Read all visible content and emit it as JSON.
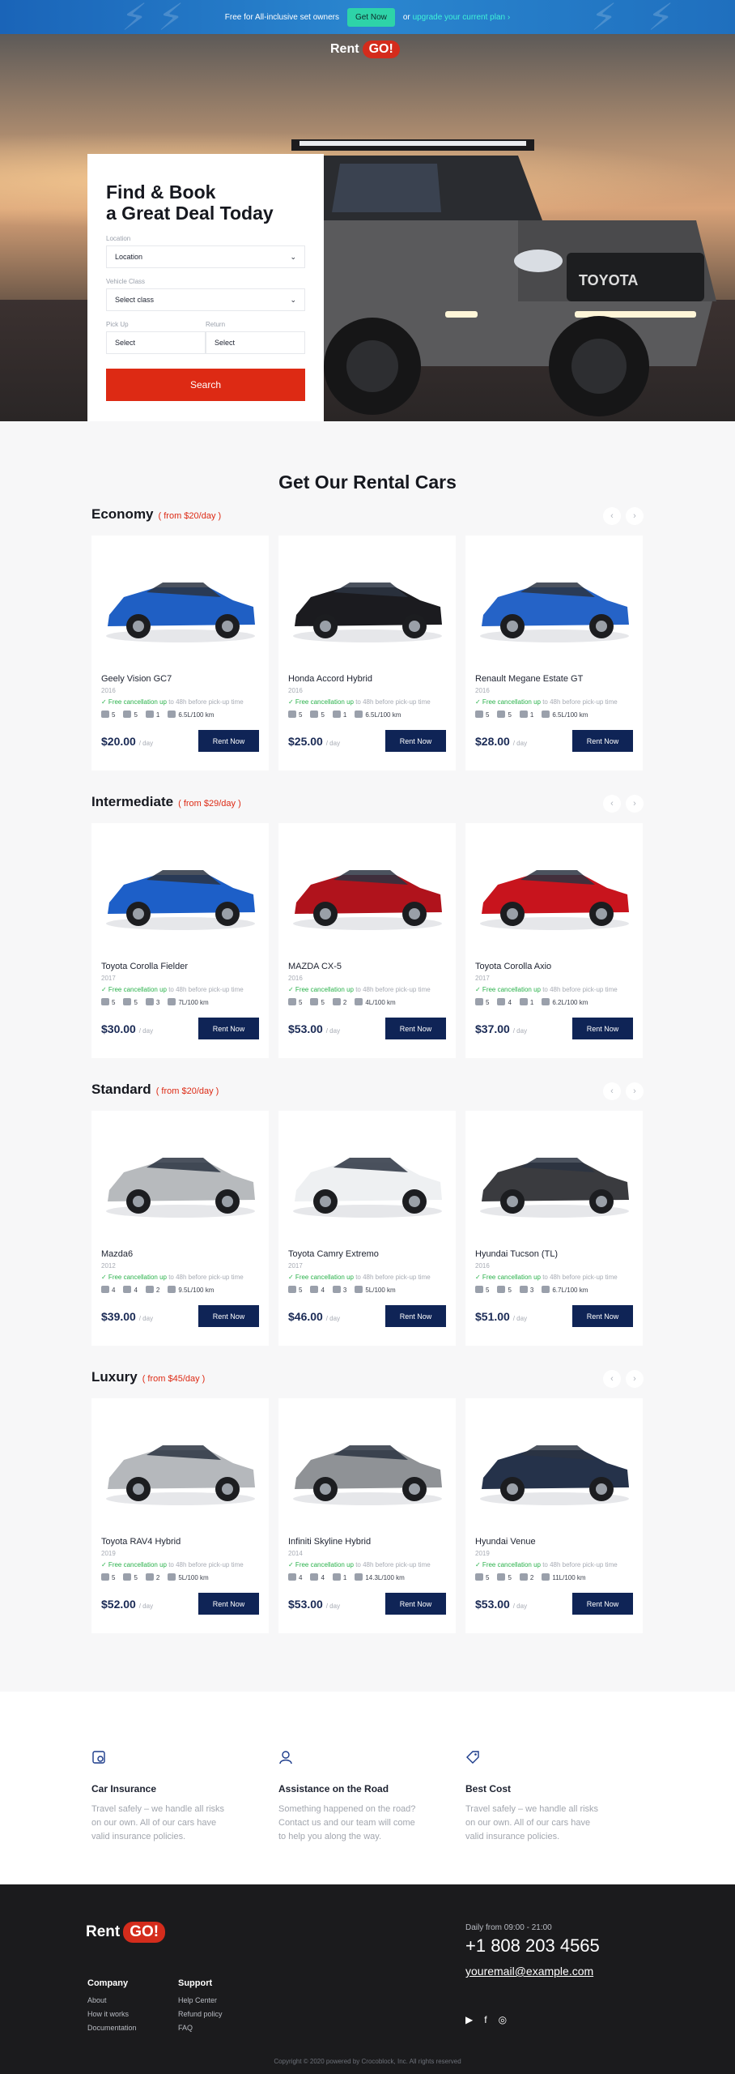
{
  "promo": {
    "text": "Free for All-inclusive set owners",
    "button": "Get Now",
    "or": "or",
    "upgrade": "upgrade your current plan ›"
  },
  "brand": {
    "rent": "Rent",
    "go": "GO!"
  },
  "finder": {
    "title_line1": "Find & Book",
    "title_line2": "a Great Deal Today",
    "location_label": "Location",
    "location_value": "Location",
    "class_label": "Vehicle Class",
    "class_value": "Select class",
    "pickup_label": "Pick Up",
    "pickup_value": "Select",
    "return_label": "Return",
    "return_value": "Select",
    "search": "Search"
  },
  "section_title": "Get Our Rental Cars",
  "free_cancel": "✓ Free cancellation up",
  "cancel_rest": " to 48h before pick-up time",
  "per_day": "/ day",
  "rent_now": "Rent Now",
  "categories": [
    {
      "name": "Economy",
      "from": "( from $20/day )",
      "cars": [
        {
          "model": "Geely Vision GC7",
          "year": "2016",
          "seats": "5",
          "doors": "5",
          "bags": "1",
          "fuel": "6.5L/100 km",
          "price": "$20.00",
          "color": "#1f5fc4"
        },
        {
          "model": "Honda Accord Hybrid",
          "year": "2016",
          "seats": "5",
          "doors": "5",
          "bags": "1",
          "fuel": "6.5L/100 km",
          "price": "$25.00",
          "color": "#1b1b1f"
        },
        {
          "model": "Renault Megane Estate GT",
          "year": "2016",
          "seats": "5",
          "doors": "5",
          "bags": "1",
          "fuel": "6.5L/100 km",
          "price": "$28.00",
          "color": "#2563c7"
        }
      ]
    },
    {
      "name": "Intermediate",
      "from": "( from $29/day )",
      "cars": [
        {
          "model": "Toyota Corolla Fielder",
          "year": "2017",
          "seats": "5",
          "doors": "5",
          "bags": "3",
          "fuel": "7L/100 km",
          "price": "$30.00",
          "color": "#1d5fc8"
        },
        {
          "model": "MAZDA CX-5",
          "year": "2016",
          "seats": "5",
          "doors": "5",
          "bags": "2",
          "fuel": "4L/100 km",
          "price": "$53.00",
          "color": "#b0131c"
        },
        {
          "model": "Toyota Corolla Axio",
          "year": "2017",
          "seats": "5",
          "doors": "4",
          "bags": "1",
          "fuel": "6.2L/100 km",
          "price": "$37.00",
          "color": "#c8141d"
        }
      ]
    },
    {
      "name": "Standard",
      "from": "( from $20/day )",
      "cars": [
        {
          "model": "Mazda6",
          "year": "2012",
          "seats": "4",
          "doors": "4",
          "bags": "2",
          "fuel": "9.5L/100 km",
          "price": "$39.00",
          "color": "#b7babd"
        },
        {
          "model": "Toyota Camry Extremo",
          "year": "2017",
          "seats": "5",
          "doors": "4",
          "bags": "3",
          "fuel": "5L/100 km",
          "price": "$46.00",
          "color": "#eef0f2"
        },
        {
          "model": "Hyundai Tucson (TL)",
          "year": "2016",
          "seats": "5",
          "doors": "5",
          "bags": "3",
          "fuel": "6.7L/100 km",
          "price": "$51.00",
          "color": "#3a3b3f"
        }
      ]
    },
    {
      "name": "Luxury",
      "from": "( from $45/day )",
      "cars": [
        {
          "model": "Toyota RAV4 Hybrid",
          "year": "2019",
          "seats": "5",
          "doors": "5",
          "bags": "2",
          "fuel": "5L/100 km",
          "price": "$52.00",
          "color": "#b5b8bc"
        },
        {
          "model": "Infiniti Skyline Hybrid",
          "year": "2014",
          "seats": "4",
          "doors": "4",
          "bags": "1",
          "fuel": "14.3L/100 km",
          "price": "$53.00",
          "color": "#8f9296"
        },
        {
          "model": "Hyundai Venue",
          "year": "2019",
          "seats": "5",
          "doors": "5",
          "bags": "2",
          "fuel": "11L/100 km",
          "price": "$53.00",
          "color": "#25324a"
        }
      ]
    }
  ],
  "features": [
    {
      "title": "Car Insurance",
      "text1": "Travel safely – we handle all risks",
      "text2": "on our own. All of our cars have",
      "text3": "valid insurance policies."
    },
    {
      "title": "Assistance on the Road",
      "text1": "Something happened on the road?",
      "text2": "Contact us and our team will come",
      "text3": "to help you along the way."
    },
    {
      "title": "Best Cost",
      "text1": "Travel safely – we handle all risks",
      "text2": "on our own. All of our cars have",
      "text3": "valid insurance policies."
    }
  ],
  "footer": {
    "company_title": "Company",
    "company_links": [
      "About",
      "How it works",
      "Documentation"
    ],
    "support_title": "Support",
    "support_links": [
      "Help Center",
      "Refund policy",
      "FAQ"
    ],
    "hours": "Daily from 09:00 - 21:00",
    "phone": "+1 808 203 4565",
    "email": "youremail@example.com",
    "copyright": "Copyright © 2020 powered by Crocoblock, Inc. All rights reserved"
  }
}
